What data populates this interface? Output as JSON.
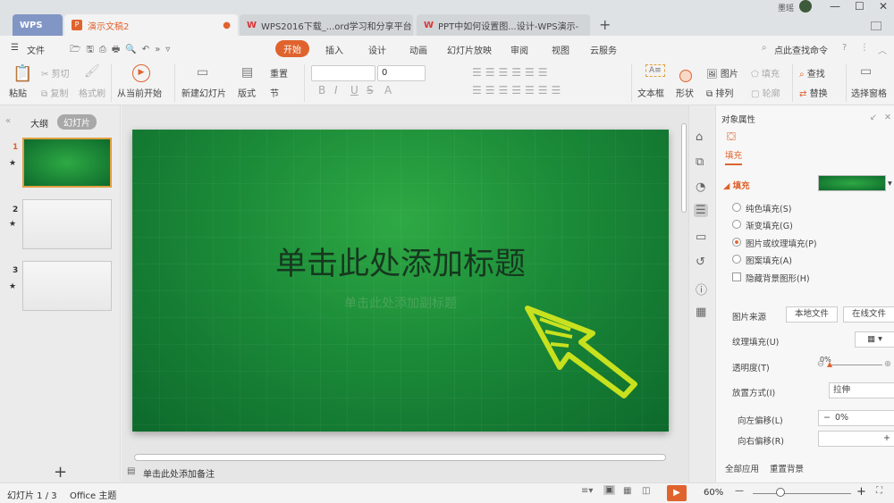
{
  "titlebar": {
    "tabs": [
      "WPS",
      "演示文稿2",
      "WPS2016下载_...ord学习和分享平台",
      "PPT中如何设置图...设计-WPS演示-"
    ],
    "new_tab": "+",
    "user": "墨瑶",
    "minimize": "—",
    "maximize": "☐",
    "close": "✕"
  },
  "menubar": {
    "file": "文件",
    "items": [
      "开始",
      "插入",
      "设计",
      "动画",
      "幻灯片放映",
      "审阅",
      "视图",
      "云服务"
    ],
    "search": "点此查找命令",
    "help": "?",
    "more": "⋮",
    "collapse": "︿"
  },
  "ribbon": {
    "paste": "粘贴",
    "cut": "剪切",
    "copy": "复制",
    "format_painter": "格式刷",
    "play_from_current": "从当前开始",
    "new_slide": "新建幻灯片",
    "layout": "版式",
    "reset": "重置",
    "section": "节",
    "font_name": "",
    "font_size": "0",
    "bold": "B",
    "italic": "I",
    "underline": "U",
    "strike": "S",
    "font_color": "A",
    "text_box": "文本框",
    "shape": "形状",
    "picture": "图片",
    "fill": "填充",
    "arrange": "排列",
    "outline": "轮廓",
    "find": "查找",
    "replace": "替换",
    "selection_pane": "选择窗格"
  },
  "left_panel": {
    "tab_outline": "大纲",
    "tab_slides": "幻灯片",
    "slides": [
      "1",
      "2",
      "3"
    ],
    "add": "+"
  },
  "slide": {
    "title": "单击此处添加标题",
    "subtitle": "单击此处添加副标题"
  },
  "notes": {
    "placeholder": "单击此处添加备注"
  },
  "props": {
    "title": "对象属性",
    "tab": "填充",
    "section": "填充",
    "fill_color": "#1b8a38",
    "options": [
      "纯色填充(S)",
      "渐变填充(G)",
      "图片或纹理填充(P)",
      "图案填充(A)"
    ],
    "selected_option": 2,
    "hide_bg": "隐藏背景图形(H)",
    "source_label": "图片来源",
    "local_file": "本地文件",
    "online_file": "在线文件",
    "texture_label": "纹理填充(U)",
    "transparency_label": "透明度(T)",
    "transparency_value": "0%",
    "transparency": 0,
    "placement_label": "放置方式(I)",
    "placement_value": "拉伸",
    "offset_x_label": "向左偏移(L)",
    "offset_x": "0%",
    "offset_y_label": "向右偏移(R)",
    "apply_all": "全部应用",
    "reset_bg": "重置背景"
  },
  "status": {
    "slide_count": "幻灯片 1 / 3",
    "theme": "Office 主题",
    "zoom": "60%"
  },
  "colors": {
    "accent": "#e0632e",
    "slide_green": "#1b8a38",
    "arrow": "#c8e11e"
  }
}
